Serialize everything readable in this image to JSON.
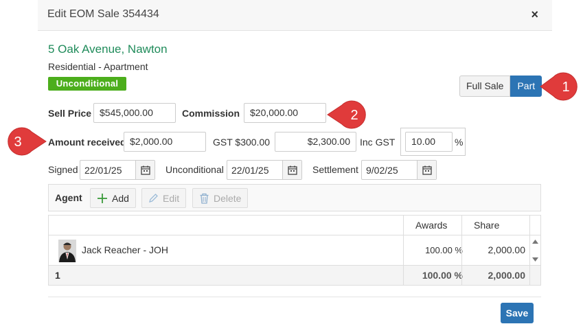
{
  "modal": {
    "title": "Edit EOM Sale 354434",
    "close": "×"
  },
  "property": {
    "address": "5 Oak Avenue, Nawton",
    "type": "Residential - Apartment",
    "status_badge": "Unconditional"
  },
  "sale_type": {
    "full_label": "Full Sale",
    "part_label": "Part",
    "selected": "Part"
  },
  "form": {
    "sell_price_label": "Sell Price",
    "sell_price_value": "$545,000.00",
    "commission_label": "Commission",
    "commission_value": "$20,000.00",
    "amount_received_label": "Amount received",
    "amount_received_value": "$2,000.00",
    "gst_label": "GST $300.00",
    "inc_gst_value": "$2,300.00",
    "inc_gst_label": "Inc GST",
    "gst_rate_value": "10.00",
    "gst_rate_unit": "%",
    "signed_label": "Signed",
    "signed_value": "22/01/25",
    "unconditional_label": "Unconditional",
    "unconditional_value": "22/01/25",
    "settlement_label": "Settlement",
    "settlement_value": "9/02/25"
  },
  "agent_toolbar": {
    "label": "Agent",
    "add_label": "Add",
    "edit_label": "Edit",
    "delete_label": "Delete"
  },
  "agents_table": {
    "columns": {
      "awards": "Awards",
      "share": "Share"
    },
    "rows": [
      {
        "name": "Jack Reacher - JOH",
        "awards": "100.00 %",
        "share": "2,000.00"
      }
    ],
    "footer": {
      "count": "1",
      "awards": "100.00 %",
      "share": "2,000.00"
    }
  },
  "actions": {
    "save_label": "Save"
  },
  "callouts": [
    "1",
    "2",
    "3"
  ],
  "colors": {
    "primary": "#2c74b4",
    "badge": "#4cae1c",
    "address": "#1f8b5a",
    "callout": "#e03b3b"
  }
}
